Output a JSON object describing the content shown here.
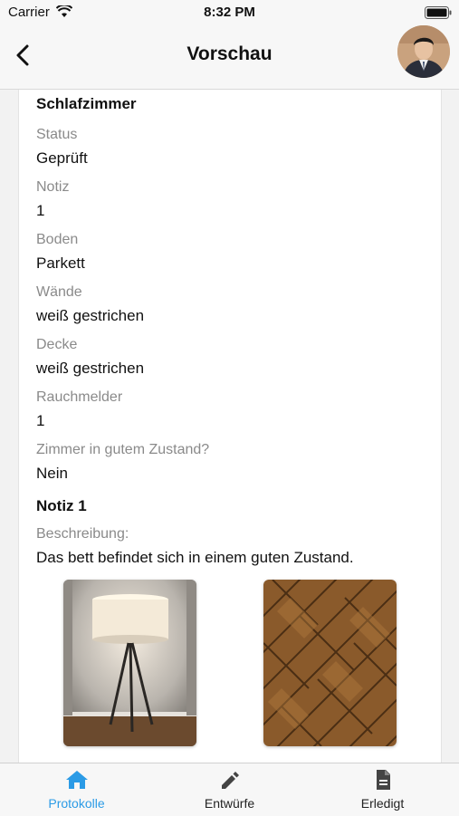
{
  "status_bar": {
    "carrier": "Carrier",
    "time": "8:32 PM"
  },
  "nav": {
    "title": "Vorschau"
  },
  "room": {
    "title": "Schlafzimmer",
    "fields": [
      {
        "label": "Status",
        "value": "Geprüft"
      },
      {
        "label": "Notiz",
        "value": "1"
      },
      {
        "label": "Boden",
        "value": "Parkett"
      },
      {
        "label": "Wände",
        "value": "weiß gestrichen"
      },
      {
        "label": "Decke",
        "value": "weiß gestrichen"
      },
      {
        "label": "Rauchmelder",
        "value": "1"
      },
      {
        "label": "Zimmer in gutem Zustand?",
        "value": "Nein"
      }
    ]
  },
  "note": {
    "title": "Notiz 1",
    "description_label": "Beschreibung:",
    "description": "Das bett befindet sich in einem guten Zustand."
  },
  "tabs": [
    {
      "label": "Protokolle",
      "icon": "home-icon",
      "active": true
    },
    {
      "label": "Entwürfe",
      "icon": "pencil-icon",
      "active": false
    },
    {
      "label": "Erledigt",
      "icon": "document-icon",
      "active": false
    }
  ],
  "colors": {
    "accent": "#2b9be6",
    "label_gray": "#8a8a8a"
  }
}
